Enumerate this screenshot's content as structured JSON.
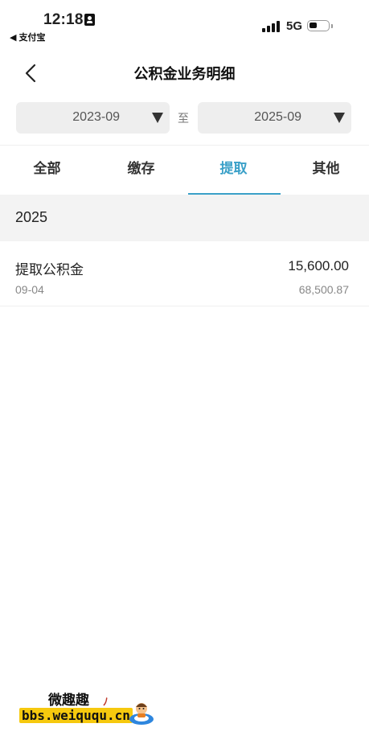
{
  "status_bar": {
    "time": "12:18",
    "back_app": "◀ 支付宝",
    "network": "5G"
  },
  "nav": {
    "title": "公积金业务明细"
  },
  "date_range": {
    "start": "2023-09",
    "separator": "至",
    "end": "2025-09"
  },
  "tabs": [
    {
      "label": "全部",
      "active": false
    },
    {
      "label": "缴存",
      "active": false
    },
    {
      "label": "提取",
      "active": true
    },
    {
      "label": "其他",
      "active": false
    }
  ],
  "groups": [
    {
      "year": "2025",
      "records": [
        {
          "title": "提取公积金",
          "amount": "15,600.00",
          "date": "09-04",
          "balance": "68,500.87"
        }
      ]
    }
  ],
  "watermark": {
    "top_text": "微趣趣",
    "url": "bbs.weiququ.cn"
  },
  "colors": {
    "accent": "#3aa0c8",
    "section_bg": "#f3f3f3",
    "select_bg": "#eeeeee"
  }
}
